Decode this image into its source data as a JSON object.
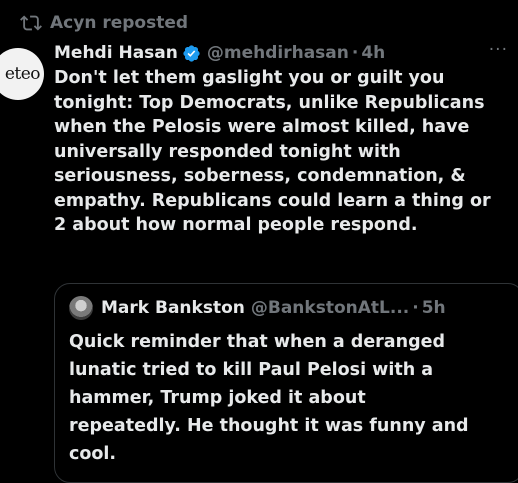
{
  "repost": {
    "icon": "repost-icon",
    "label": "Acyn reposted"
  },
  "tweet": {
    "avatar_text": "eteo",
    "display_name": "Mehdi Hasan",
    "verified_icon": "verified-badge-icon",
    "handle": "@mehdirhasan",
    "separator": "·",
    "time": "4h",
    "more_icon": "more-horizontal-icon",
    "more_glyph": "···",
    "text": "Don't let them gaslight you or guilt you\ntonight: Top Democrats, unlike Republicans\nwhen the Pelosis were almost killed, have\nuniversally responded tonight with\nseriousness, soberness, condemnation, &\nempathy. Republicans could learn a thing or\n2 about how normal people respond."
  },
  "quote": {
    "display_name": "Mark Bankston",
    "handle": "@BankstonAtL...",
    "separator": "·",
    "time": "5h",
    "text": "Quick reminder that when a deranged\nlunatic tried to kill Paul Pelosi with a\nhammer, Trump joked it about\nrepeatedly. He thought it was funny and\ncool."
  },
  "colors": {
    "background": "#000000",
    "primary_text": "#e7e9ea",
    "secondary_text": "#71767b",
    "verified_blue": "#1d9bf0",
    "border": "#2f3336"
  }
}
